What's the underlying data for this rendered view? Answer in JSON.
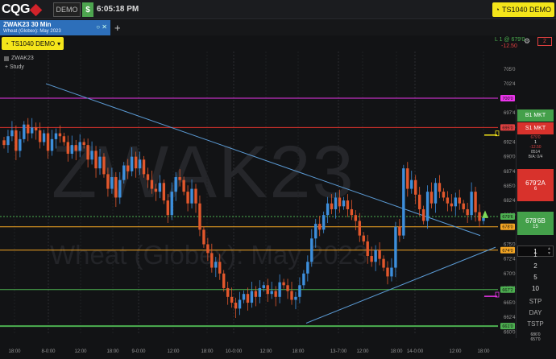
{
  "app": {
    "logo_text": "CQG",
    "mode_label": "DEMO",
    "dollar_label": "$",
    "time": "6:05:18 PM",
    "account": "TS1040 DEMO"
  },
  "tab": {
    "title": "ZWAK23 30 Min",
    "subtitle": "Wheat (Globex): May 2023",
    "add_label": "+"
  },
  "toolbar": {
    "account_label": "TS1040 DEMO",
    "status_line": "L 1 @ 679'0",
    "pnl": "-12.50",
    "count_value": "2"
  },
  "chart": {
    "symbol": "ZWAK23",
    "symbol_description": "Wheat (Globex): May 2023",
    "study_label": "+ Study",
    "watermark_symbol": "ZWAK23",
    "watermark_desc": "Wheat (Globex): May 2023",
    "y_ticks": [
      "705'0",
      "702'4",
      "697'4",
      "695'0",
      "692'4",
      "690'0",
      "687'4",
      "685'0",
      "682'4",
      "680'0",
      "675'0",
      "672'4",
      "670'0",
      "667'4",
      "665'0",
      "662'4",
      "660'0"
    ],
    "price_tags": [
      {
        "value": "700'0",
        "color": "#ea34ea"
      },
      {
        "value": "695'0",
        "color": "#e04040"
      },
      {
        "value": "679'6",
        "color": "#4caf50"
      },
      {
        "value": "678'0",
        "color": "#f5a623"
      },
      {
        "value": "674'0",
        "color": "#f5a623"
      },
      {
        "value": "667'2",
        "color": "#4caf50"
      },
      {
        "value": "661'0",
        "color": "#4caf50"
      }
    ],
    "x_labels": [
      "18:00",
      "8-0:00",
      "12:00",
      "18:00",
      "9-0:00",
      "12:00",
      "18:00",
      "10-0:00",
      "12:00",
      "18:00",
      "13-7:00",
      "12:00",
      "18:00",
      "14-0:00",
      "12:00",
      "18:00"
    ],
    "colors": {
      "up": "#3d8fdc",
      "down": "#e2572c",
      "magenta": "#ea34ea",
      "red": "#d8322c",
      "orange": "#f5a623",
      "green": "#4caf50",
      "trend": "#5b9bd5"
    }
  },
  "dom": {
    "buy_market": "B1 MKT",
    "buy_market_qty": "",
    "sell_market": "S1 MKT",
    "pos_price": "679'0",
    "pos_qty": "1",
    "pos_pnl": "-12.50",
    "vol": "8514",
    "bid_ask_sizes": "B/A: 0/4",
    "ask_price": "679'2A",
    "ask_size": "6",
    "bid_price": "678'6B",
    "bid_size": "15",
    "qty_value": "1",
    "quantities": [
      "1",
      "2",
      "5",
      "10"
    ],
    "order_types": [
      "STP",
      "DAY",
      "TSTP"
    ],
    "bottom_line1": "686'0",
    "bottom_line2": "657'0"
  },
  "chart_data": {
    "type": "candlestick",
    "y_axis_labels": [
      "705'0",
      "702'4",
      "697'4",
      "695'0",
      "692'4",
      "690'0",
      "687'4",
      "685'0",
      "682'4",
      "680'0",
      "675'0",
      "672'4",
      "670'0",
      "667'4",
      "665'0",
      "662'4",
      "660'0"
    ],
    "x_axis_labels": [
      "18:00",
      "8-0:00",
      "12:00",
      "18:00",
      "9-0:00",
      "12:00",
      "18:00",
      "10-0:00",
      "12:00",
      "18:00",
      "13-7:00",
      "12:00",
      "18:00",
      "14-0:00",
      "12:00",
      "18:00"
    ],
    "close_path": [
      692.0,
      693.5,
      694.5,
      691.0,
      693.0,
      695.5,
      694.0,
      695.0,
      694.5,
      692.5,
      694.0,
      691.0,
      693.0,
      694.0,
      693.5,
      692.5,
      690.5,
      692.0,
      691.0,
      692.5,
      692.0,
      689.5,
      691.0,
      688.0,
      690.0,
      687.0,
      684.5,
      686.5,
      683.0,
      686.0,
      688.5,
      687.5,
      690.0,
      688.0,
      689.5,
      687.0,
      686.0,
      684.5,
      684.0,
      685.5,
      682.5,
      680.0,
      684.0,
      686.5,
      686.0,
      684.0,
      682.0,
      684.5,
      682.0,
      677.5,
      675.0,
      673.5,
      671.0,
      672.0,
      670.0,
      667.5,
      666.0,
      665.0,
      664.0,
      665.5,
      666.5,
      665.0,
      667.0,
      666.0,
      667.5,
      668.0,
      666.5,
      667.0,
      666.0,
      668.5,
      668.0,
      667.0,
      665.5,
      666.0,
      668.0,
      670.0,
      672.0,
      676.0,
      678.5,
      677.5,
      680.0,
      682.0,
      681.0,
      683.0,
      681.5,
      682.5,
      681.0,
      680.0,
      679.0,
      676.5,
      675.5,
      673.0,
      672.0,
      674.0,
      672.5,
      671.0,
      669.5,
      671.0,
      678.0,
      676.5,
      688.0,
      684.5,
      686.0,
      683.5,
      681.0,
      679.0,
      684.0,
      682.0,
      685.5,
      684.0,
      683.0,
      682.0,
      681.5,
      683.0,
      682.0,
      681.0,
      680.0,
      684.0,
      680.5,
      679.0,
      679.5
    ],
    "horizontal_levels": [
      700.0,
      695.0,
      679.75,
      678.0,
      674.0,
      667.25,
      661.0
    ],
    "y_range": [
      659.5,
      708.0
    ]
  }
}
